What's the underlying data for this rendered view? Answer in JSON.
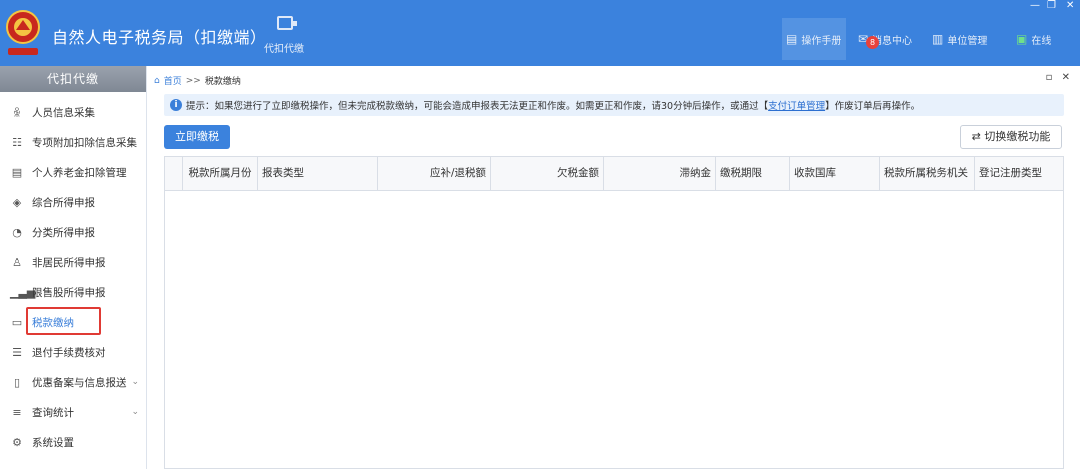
{
  "header": {
    "app_title": "自然人电子税务局（扣缴端）",
    "module_label": "代扣代缴",
    "nav": [
      {
        "icon": "document-icon",
        "label": "操作手册"
      },
      {
        "icon": "mail-icon",
        "label": "消息中心",
        "badge": "8"
      },
      {
        "icon": "building-icon",
        "label": "单位管理"
      },
      {
        "icon": "monitor-icon",
        "label": "在线"
      }
    ]
  },
  "sidebar": {
    "title": "代扣代缴",
    "items": [
      {
        "label": "人员信息采集",
        "icon": "user-icon"
      },
      {
        "label": "专项附加扣除信息采集",
        "icon": "list-icon"
      },
      {
        "label": "个人养老金扣除管理",
        "icon": "pension-icon"
      },
      {
        "label": "综合所得申报",
        "icon": "layers-icon"
      },
      {
        "label": "分类所得申报",
        "icon": "pie-icon"
      },
      {
        "label": "非居民所得申报",
        "icon": "person-icon"
      },
      {
        "label": "限售股所得申报",
        "icon": "bar-chart-icon"
      },
      {
        "label": "税款缴纳",
        "icon": "wallet-icon"
      },
      {
        "label": "退付手续费核对",
        "icon": "checklist-icon"
      },
      {
        "label": "优惠备案与信息报送",
        "icon": "file-icon"
      },
      {
        "label": "查询统计",
        "icon": "search-list-icon"
      },
      {
        "label": "系统设置",
        "icon": "gear-icon"
      }
    ]
  },
  "breadcrumb": {
    "home": "首页",
    "separator": ">>",
    "current": "税款缴纳"
  },
  "notice": {
    "prefix": "提示：如果您进行了立即缴税操作，但未完成税款缴纳，可能会造成申报表无法更正和作废。如需更正和作废，请30分钟后操作，或通过【",
    "link": "支付订单管理",
    "suffix": "】作废订单后再操作。"
  },
  "toolbar": {
    "pay_now": "立即缴税",
    "switch_mode": "切换缴税功能"
  },
  "table": {
    "columns": [
      "税款所属月份",
      "报表类型",
      "应补/退税额",
      "欠税金额",
      "滞纳金",
      "缴税期限",
      "收款国库",
      "税款所属税务机关",
      "登记注册类型"
    ],
    "rows": []
  },
  "colors": {
    "header_bg": "#3b82dd",
    "accent": "#3b7fd9",
    "highlight_border": "#e03a34"
  }
}
